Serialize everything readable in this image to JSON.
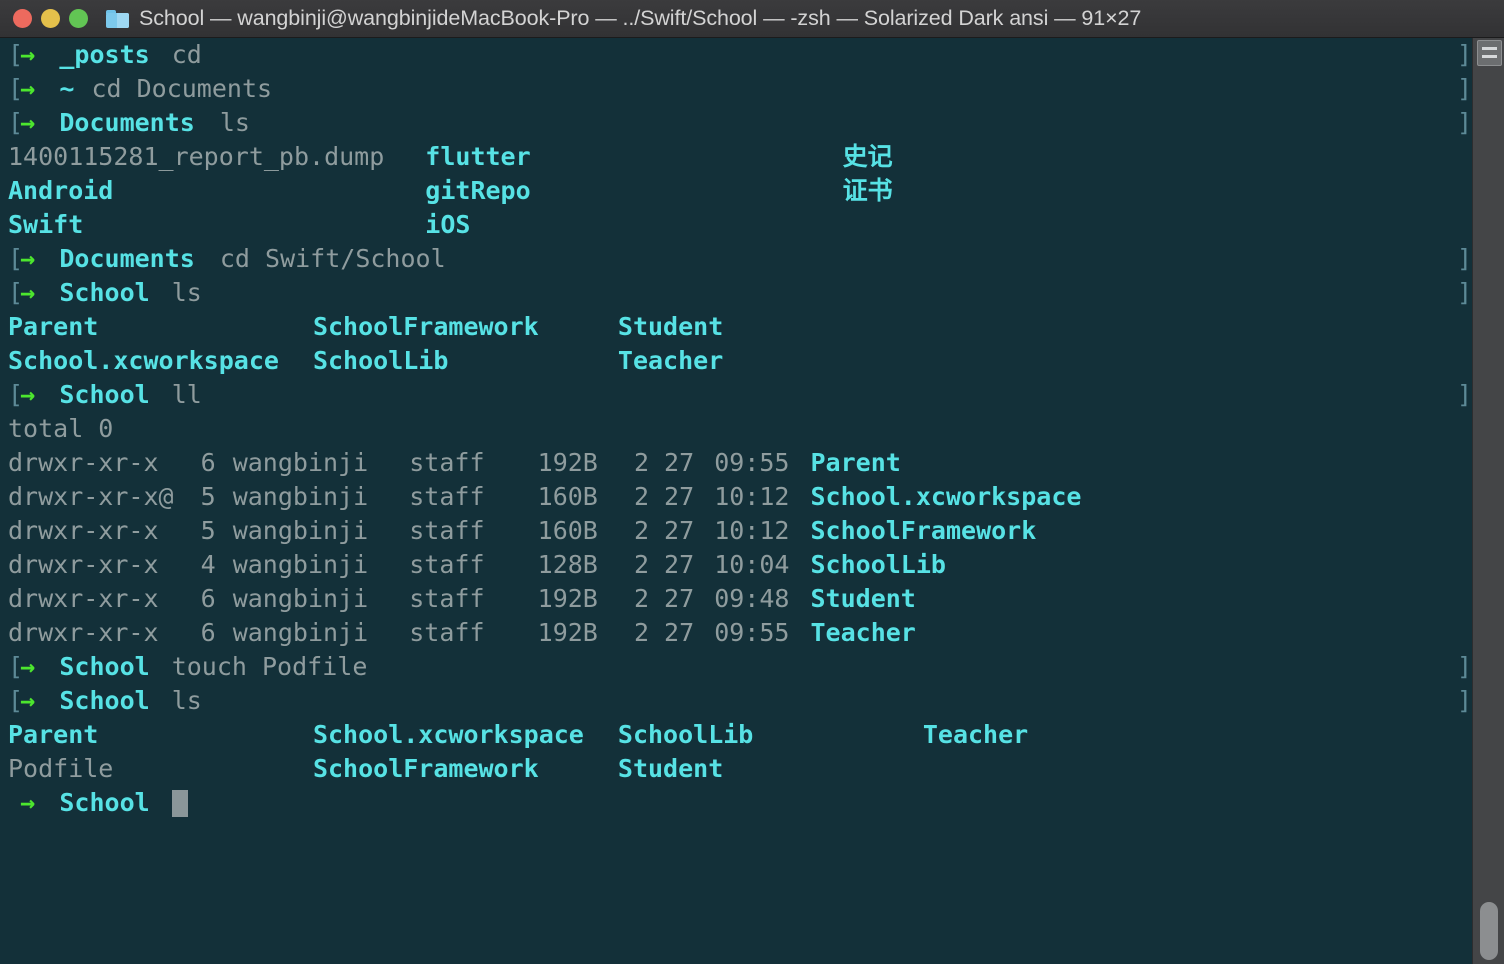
{
  "window": {
    "title": "School — wangbinji@wangbinjideMacBook-Pro — ../Swift/School — -zsh — Solarized Dark ansi — 91×27",
    "folder_name": "School",
    "user_host": "wangbinji@wangbinjideMacBook-Pro",
    "path": "../Swift/School",
    "shell": "-zsh",
    "profile": "Solarized Dark ansi",
    "size": "91×27",
    "controls": {
      "close": "close",
      "minimize": "minimize",
      "maximize": "maximize"
    }
  },
  "colors": {
    "background": "#133039",
    "titlebar": "#3b3b3d",
    "dim_text": "#8f9c9e",
    "cyan_bold": "#57e2e5",
    "green_arrow": "#4ce62e",
    "bracket": "#5d8a97",
    "cursor": "#8a9699"
  },
  "terminal": {
    "prompt_open_bracket": "[",
    "prompt_arrow": "→",
    "prompt_close_bracket": "]",
    "lines": [
      {
        "type": "prompt",
        "cwd": "_posts",
        "command": "cd",
        "bracket": true
      },
      {
        "type": "prompt",
        "cwd": "~",
        "command": "cd Documents",
        "bracket": true
      },
      {
        "type": "prompt",
        "cwd": "Documents",
        "command": "ls",
        "bracket": true
      },
      {
        "type": "cols",
        "columns": [
          {
            "text": "1400115281_report_pb.dump",
            "style": "file",
            "col": 0
          },
          {
            "text": "flutter",
            "style": "dir",
            "col": 26
          },
          {
            "text": "史记",
            "style": "dir",
            "col": 52
          }
        ]
      },
      {
        "type": "cols",
        "columns": [
          {
            "text": "Android",
            "style": "dir",
            "col": 0
          },
          {
            "text": "gitRepo",
            "style": "dir",
            "col": 26
          },
          {
            "text": "证书",
            "style": "dir",
            "col": 52
          }
        ]
      },
      {
        "type": "cols",
        "columns": [
          {
            "text": "Swift",
            "style": "dir",
            "col": 0
          },
          {
            "text": "iOS",
            "style": "dir",
            "col": 26
          }
        ]
      },
      {
        "type": "prompt",
        "cwd": "Documents",
        "command": "cd Swift/School",
        "bracket": true
      },
      {
        "type": "prompt",
        "cwd": "School",
        "command": "ls",
        "bracket": true
      },
      {
        "type": "cols",
        "columns": [
          {
            "text": "Parent",
            "style": "dir",
            "col": 0
          },
          {
            "text": "SchoolFramework",
            "style": "dir",
            "col": 19
          },
          {
            "text": "Student",
            "style": "dir",
            "col": 38
          }
        ]
      },
      {
        "type": "cols",
        "columns": [
          {
            "text": "School.xcworkspace",
            "style": "dir",
            "col": 0
          },
          {
            "text": "SchoolLib",
            "style": "dir",
            "col": 19
          },
          {
            "text": "Teacher",
            "style": "dir",
            "col": 38
          }
        ]
      },
      {
        "type": "prompt",
        "cwd": "School",
        "command": "ll",
        "bracket": true
      },
      {
        "type": "plain",
        "text": "total 0"
      },
      {
        "type": "ll",
        "perms": "drwxr-xr-x ",
        "links": "6",
        "owner": "wangbinji",
        "group": "staff",
        "size": "192B",
        "date": "2 27",
        "time": "09:55",
        "name": "Parent",
        "style": "dir"
      },
      {
        "type": "ll",
        "perms": "drwxr-xr-x@",
        "links": "5",
        "owner": "wangbinji",
        "group": "staff",
        "size": "160B",
        "date": "2 27",
        "time": "10:12",
        "name": "School.xcworkspace",
        "style": "dir"
      },
      {
        "type": "ll",
        "perms": "drwxr-xr-x ",
        "links": "5",
        "owner": "wangbinji",
        "group": "staff",
        "size": "160B",
        "date": "2 27",
        "time": "10:12",
        "name": "SchoolFramework",
        "style": "dir"
      },
      {
        "type": "ll",
        "perms": "drwxr-xr-x ",
        "links": "4",
        "owner": "wangbinji",
        "group": "staff",
        "size": "128B",
        "date": "2 27",
        "time": "10:04",
        "name": "SchoolLib",
        "style": "dir"
      },
      {
        "type": "ll",
        "perms": "drwxr-xr-x ",
        "links": "6",
        "owner": "wangbinji",
        "group": "staff",
        "size": "192B",
        "date": "2 27",
        "time": "09:48",
        "name": "Student",
        "style": "dir"
      },
      {
        "type": "ll",
        "perms": "drwxr-xr-x ",
        "links": "6",
        "owner": "wangbinji",
        "group": "staff",
        "size": "192B",
        "date": "2 27",
        "time": "09:55",
        "name": "Teacher",
        "style": "dir"
      },
      {
        "type": "prompt",
        "cwd": "School",
        "command": "touch Podfile",
        "bracket": true
      },
      {
        "type": "prompt",
        "cwd": "School",
        "command": "ls",
        "bracket": true
      },
      {
        "type": "cols",
        "columns": [
          {
            "text": "Parent",
            "style": "dir",
            "col": 0
          },
          {
            "text": "School.xcworkspace",
            "style": "dir",
            "col": 19
          },
          {
            "text": "SchoolLib",
            "style": "dir",
            "col": 38
          },
          {
            "text": "Teacher",
            "style": "dir",
            "col": 57
          }
        ]
      },
      {
        "type": "cols",
        "columns": [
          {
            "text": "Podfile",
            "style": "file",
            "col": 0
          },
          {
            "text": "SchoolFramework",
            "style": "dir",
            "col": 19
          },
          {
            "text": "Student",
            "style": "dir",
            "col": 38
          }
        ]
      },
      {
        "type": "prompt",
        "cwd": "School",
        "command": "",
        "bracket": false,
        "cursor": true
      }
    ]
  },
  "gutter": {
    "menu_button": "terminal-options",
    "scroll_thumb": "scrollbar-thumb"
  }
}
